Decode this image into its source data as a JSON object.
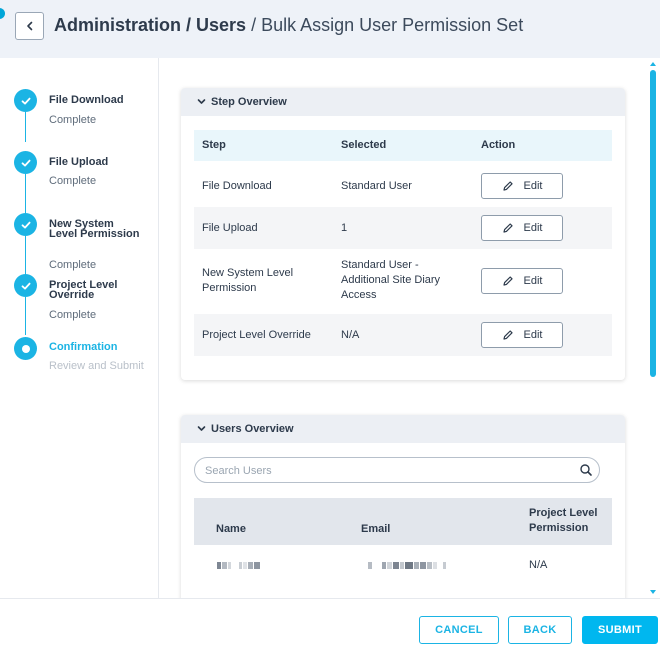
{
  "header": {
    "title_part1": "Administration",
    "title_sep1": " / ",
    "title_part2": "Users",
    "title_sep2": " / ",
    "title_part3": "Bulk Assign User Permission Set"
  },
  "stepper": {
    "steps": [
      {
        "label": "File Download",
        "status": "Complete"
      },
      {
        "label": "File Upload",
        "status": "Complete"
      },
      {
        "label": "New System Level Permission",
        "status": "Complete"
      },
      {
        "label": "Project Level Override",
        "status": "Complete"
      },
      {
        "label": "Confirmation",
        "status": "Review and Submit"
      }
    ]
  },
  "step_overview": {
    "title": "Step Overview",
    "columns": [
      "Step",
      "Selected",
      "Action"
    ],
    "rows": [
      {
        "step": "File Download",
        "selected": "Standard User",
        "action": "Edit"
      },
      {
        "step": "File Upload",
        "selected": "1",
        "action": "Edit"
      },
      {
        "step": "New System Level Permission",
        "selected": "Standard User - Additional Site Diary Access",
        "action": "Edit"
      },
      {
        "step": "Project Level Override",
        "selected": "N/A",
        "action": "Edit"
      }
    ]
  },
  "users_overview": {
    "title": "Users Overview",
    "search_placeholder": "Search Users",
    "columns": [
      "Name",
      "Email",
      "Project Level Permission"
    ],
    "rows": [
      {
        "name": "",
        "email": "",
        "permission": "N/A"
      }
    ]
  },
  "footer": {
    "cancel_label": "CANCEL",
    "back_label": "BACK",
    "submit_label": "SUBMIT"
  },
  "colors": {
    "accent": "#1bb4e4",
    "primary_button": "#00b7ef",
    "header_bg": "#eef2f8"
  },
  "icons": [
    "chevron-left-icon",
    "check-icon",
    "chevron-down-icon",
    "pencil-icon",
    "search-icon"
  ]
}
